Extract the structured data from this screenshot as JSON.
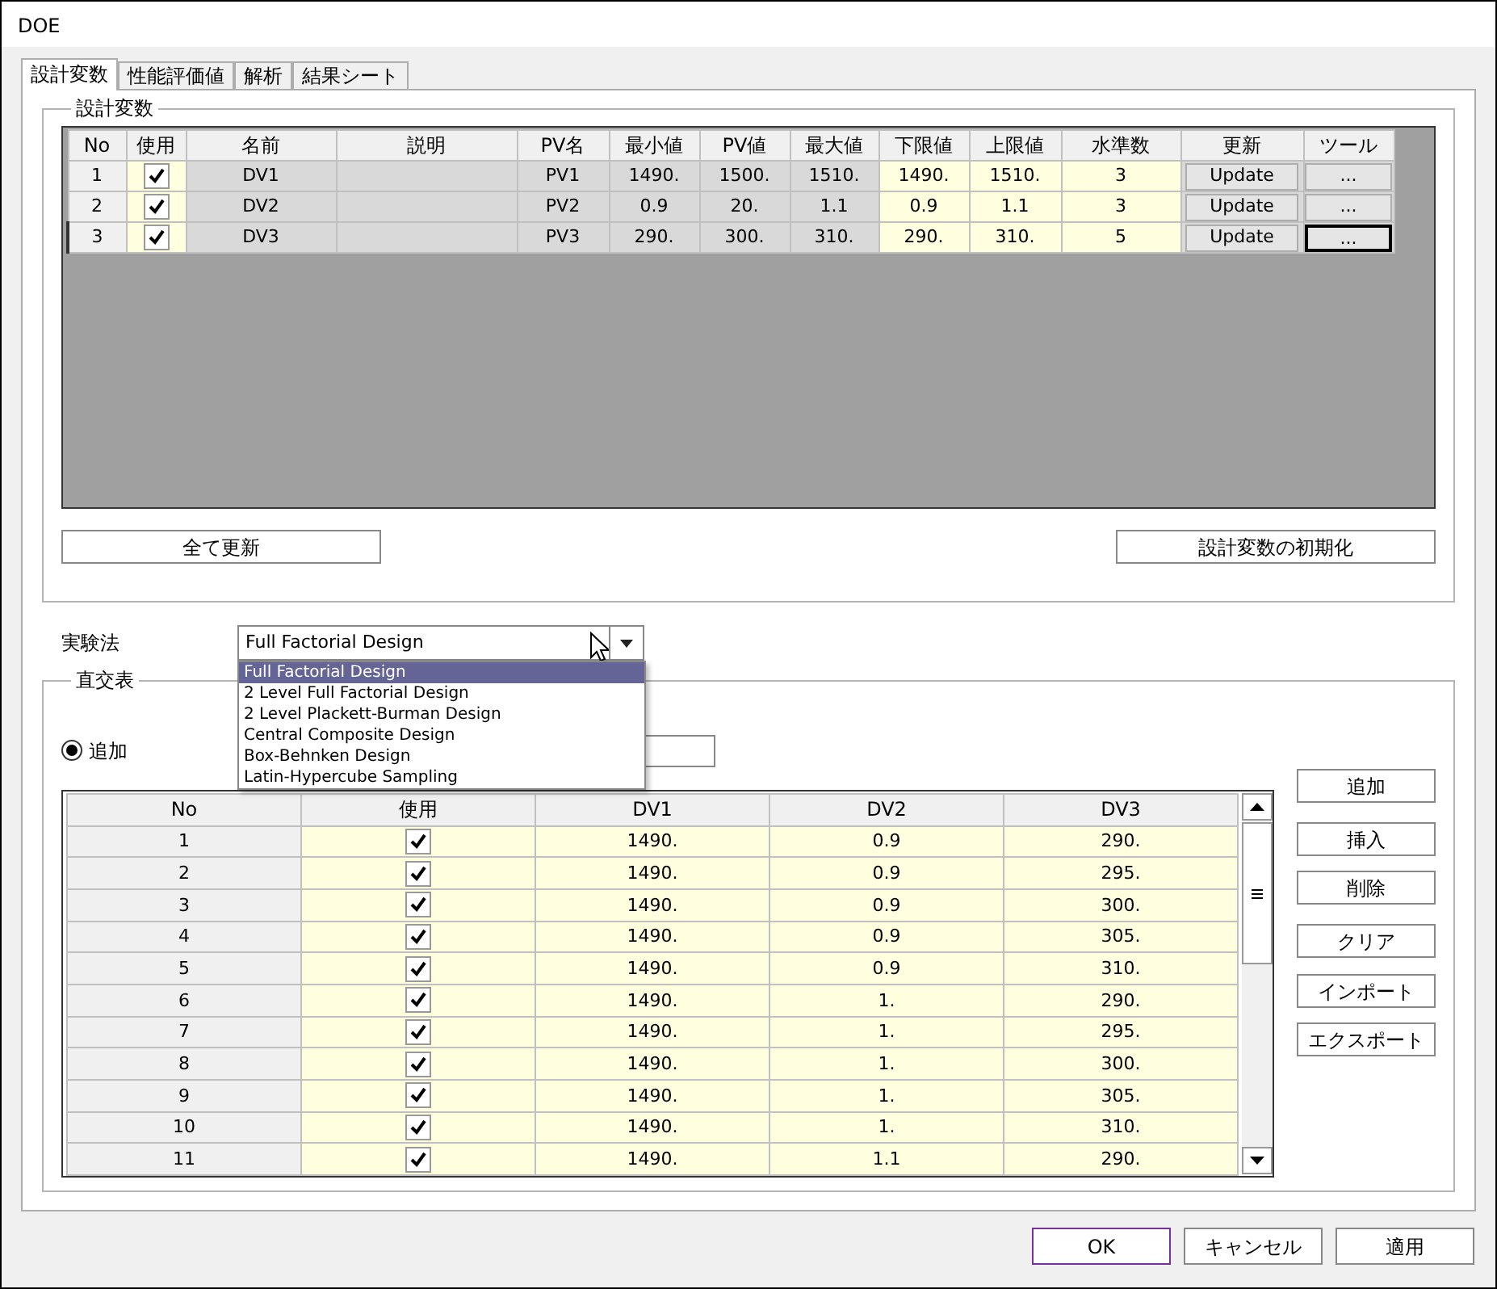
{
  "window": {
    "title": "DOE"
  },
  "tabs": [
    {
      "label": "設計変数",
      "selected": true
    },
    {
      "label": "性能評価値",
      "selected": false
    },
    {
      "label": "解析",
      "selected": false
    },
    {
      "label": "結果シート",
      "selected": false
    }
  ],
  "design_variables": {
    "title": "設計変数",
    "columns": [
      {
        "label": "No"
      },
      {
        "label": "使用",
        "editable": true
      },
      {
        "label": "名前",
        "editable": false
      },
      {
        "label": "説明",
        "editable": false
      },
      {
        "label": "PV名",
        "editable": false
      },
      {
        "label": "最小値",
        "editable": false
      },
      {
        "label": "PV値",
        "editable": false
      },
      {
        "label": "最大値",
        "editable": false
      },
      {
        "label": "下限値",
        "editable": true
      },
      {
        "label": "上限値",
        "editable": true
      },
      {
        "label": "水準数",
        "editable": true
      },
      {
        "label": "更新",
        "editable": false
      },
      {
        "label": "ツール",
        "editable": false
      }
    ],
    "rows": [
      {
        "no": "1",
        "use": true,
        "name": "DV1",
        "pv_name": "PV1",
        "min": "1490.",
        "pv": "1500.",
        "max": "1510.",
        "lower": "1490.",
        "upper": "1510.",
        "levels": "3",
        "update": "Update",
        "tool": "...",
        "current": false
      },
      {
        "no": "2",
        "use": true,
        "name": "DV2",
        "pv_name": "PV2",
        "min": "0.9",
        "pv": "20.",
        "max": "1.1",
        "lower": "0.9",
        "upper": "1.1",
        "levels": "3",
        "update": "Update",
        "tool": "...",
        "current": false
      },
      {
        "no": "3",
        "use": true,
        "name": "DV3",
        "pv_name": "PV3",
        "min": "290.",
        "pv": "300.",
        "max": "310.",
        "lower": "290.",
        "upper": "310.",
        "levels": "5",
        "update": "Update",
        "tool": "...",
        "current": true
      }
    ],
    "update_all_button": "全て更新",
    "reset_button": "設計変数の初期化"
  },
  "method": {
    "label": "実験法",
    "value": "Full Factorial Design",
    "expanded": true,
    "options": [
      {
        "label": "Full Factorial Design",
        "selected": true
      },
      {
        "label": "2 Level Full Factorial Design",
        "selected": false
      },
      {
        "label": "2 Level Plackett-Burman Design",
        "selected": false
      },
      {
        "label": "Central Composite Design",
        "selected": false
      },
      {
        "label": "Box-Behnken Design",
        "selected": false
      },
      {
        "label": "Latin-Hypercube Sampling",
        "selected": false
      }
    ]
  },
  "orthogonal_table": {
    "title": "直交表",
    "radio": {
      "label": "追加",
      "selected": true
    },
    "columns": [
      "No",
      "使用",
      "DV1",
      "DV2",
      "DV3"
    ],
    "rows": [
      {
        "no": "1",
        "use": true,
        "values": [
          "1490.",
          "0.9",
          "290."
        ]
      },
      {
        "no": "2",
        "use": true,
        "values": [
          "1490.",
          "0.9",
          "295."
        ]
      },
      {
        "no": "3",
        "use": true,
        "values": [
          "1490.",
          "0.9",
          "300."
        ]
      },
      {
        "no": "4",
        "use": true,
        "values": [
          "1490.",
          "0.9",
          "305."
        ]
      },
      {
        "no": "5",
        "use": true,
        "values": [
          "1490.",
          "0.9",
          "310."
        ]
      },
      {
        "no": "6",
        "use": true,
        "values": [
          "1490.",
          "1.",
          "290."
        ]
      },
      {
        "no": "7",
        "use": true,
        "values": [
          "1490.",
          "1.",
          "295."
        ]
      },
      {
        "no": "8",
        "use": true,
        "values": [
          "1490.",
          "1.",
          "300."
        ]
      },
      {
        "no": "9",
        "use": true,
        "values": [
          "1490.",
          "1.",
          "305."
        ]
      },
      {
        "no": "10",
        "use": true,
        "values": [
          "1490.",
          "1.",
          "310."
        ]
      },
      {
        "no": "11",
        "use": true,
        "values": [
          "1490.",
          "1.1",
          "290."
        ]
      }
    ],
    "buttons": [
      "追加",
      "挿入",
      "削除",
      "クリア",
      "インポート",
      "エクスポート"
    ]
  },
  "footer_buttons": [
    {
      "label": "OK",
      "default": true
    },
    {
      "label": "キャンセル",
      "default": false
    },
    {
      "label": "適用",
      "default": false
    }
  ]
}
